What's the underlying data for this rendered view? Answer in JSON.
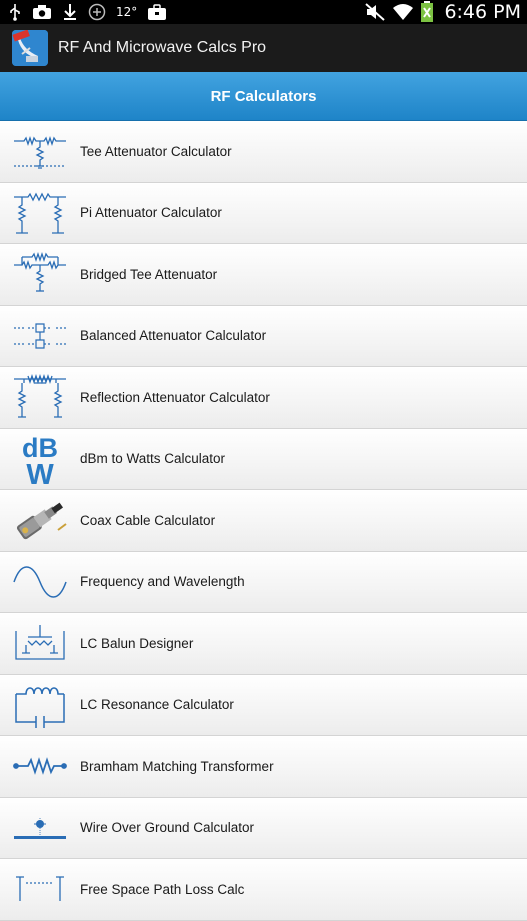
{
  "status_bar": {
    "temperature": "12°",
    "time": "6:46 PM",
    "icons": [
      "usb-icon",
      "camera-icon",
      "download-icon",
      "add-circle-icon",
      "temperature",
      "briefcase-icon",
      "mute-icon",
      "wifi-icon",
      "battery-icon"
    ]
  },
  "action_bar": {
    "app_title": "RF And Microwave Calcs Pro",
    "app_icon": "satellite-dish-icon"
  },
  "section_header": {
    "title": "RF Calculators",
    "color": "#2a92d6"
  },
  "list": {
    "items": [
      {
        "label": "Tee Attenuator Calculator",
        "icon": "tee-attenuator-icon"
      },
      {
        "label": "Pi Attenuator Calculator",
        "icon": "pi-attenuator-icon"
      },
      {
        "label": "Bridged Tee Attenuator",
        "icon": "bridged-tee-icon"
      },
      {
        "label": "Balanced Attenuator Calculator",
        "icon": "balanced-attenuator-icon"
      },
      {
        "label": "Reflection Attenuator Calculator",
        "icon": "reflection-attenuator-icon"
      },
      {
        "label": "dBm to Watts Calculator",
        "icon": "dbw-icon",
        "icon_text_top": "dB",
        "icon_text_bottom": "W"
      },
      {
        "label": "Coax Cable Calculator",
        "icon": "coax-connector-icon"
      },
      {
        "label": "Frequency and Wavelength",
        "icon": "sine-wave-icon"
      },
      {
        "label": "LC Balun Designer",
        "icon": "lc-balun-icon"
      },
      {
        "label": "LC Resonance Calculator",
        "icon": "lc-resonance-icon"
      },
      {
        "label": "Bramham Matching Transformer",
        "icon": "resistor-line-icon"
      },
      {
        "label": "Wire Over Ground Calculator",
        "icon": "wire-over-ground-icon"
      },
      {
        "label": "Free Space Path Loss Calc",
        "icon": "antenna-pair-icon"
      }
    ]
  }
}
